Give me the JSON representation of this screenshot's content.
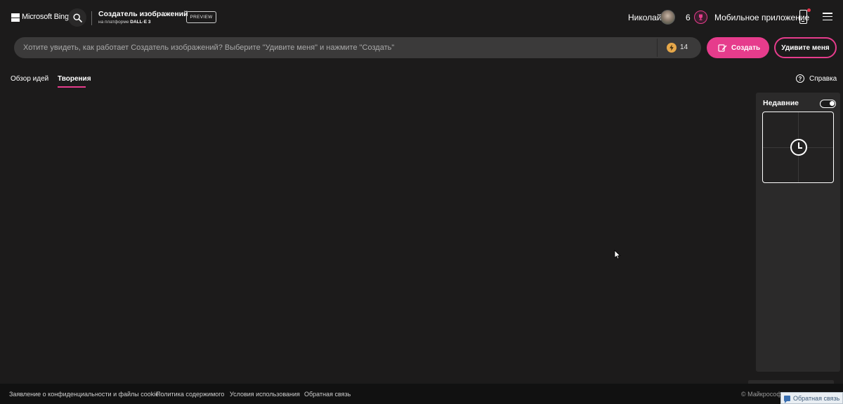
{
  "header": {
    "brand": "Microsoft Bing",
    "app_title": "Создатель изображений",
    "app_subtitle_prefix": "на платформе ",
    "app_subtitle_model": "DALL·E 3",
    "preview_badge": "PREVIEW",
    "user_name": "Николай",
    "rewards_count": "6",
    "mobile_app": "Мобильное приложение"
  },
  "prompt": {
    "placeholder": "Хотите увидеть, как работает Создатель изображений? Выберите \"Удивите меня\" и нажмите \"Создать\"",
    "value": "",
    "boosts": "14"
  },
  "buttons": {
    "create": "Создать",
    "surprise": "Удивите меня"
  },
  "tabs": {
    "explore": "Обзор идей",
    "creations": "Творения",
    "active": "creations"
  },
  "help": {
    "label": "Справка"
  },
  "recent": {
    "title": "Недавние",
    "toggle_on": true
  },
  "footer": {
    "links": [
      "Заявление о конфиденциальности и файлы cookie",
      "Политика содержимого",
      "Условия использования",
      "Обратная связь"
    ],
    "copyright": "© Майкрософ",
    "feedback_button": "Обратная связь"
  },
  "colors": {
    "accent": "#e63c8c",
    "background": "#1c1b1b",
    "panel": "#2b2a2a",
    "boost": "#e7a84a"
  },
  "icons": {
    "logo": "microsoft-logo-icon",
    "search": "search-icon",
    "rewards": "trophy-icon",
    "phone": "phone-icon",
    "menu": "hamburger-menu-icon",
    "boost": "lightning-icon",
    "create": "create-icon",
    "help": "help-icon",
    "recent": "clock-icon"
  }
}
